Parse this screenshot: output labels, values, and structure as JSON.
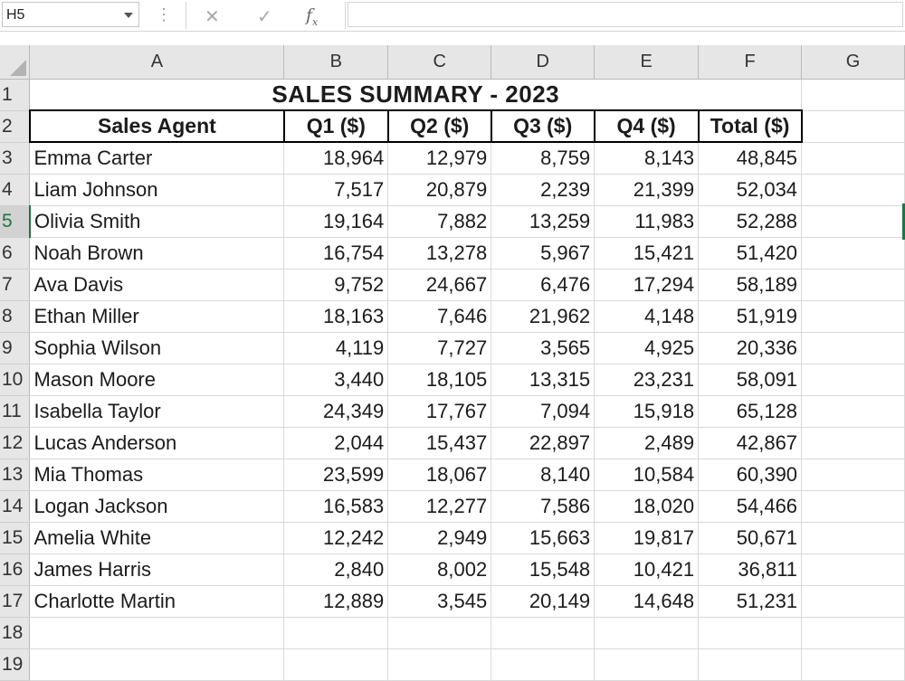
{
  "formula_bar": {
    "name_box": "H5",
    "formula": ""
  },
  "columns": [
    "A",
    "B",
    "C",
    "D",
    "E",
    "F",
    "G"
  ],
  "row_numbers": [
    "1",
    "2",
    "3",
    "4",
    "5",
    "6",
    "7",
    "8",
    "9",
    "10",
    "11",
    "12",
    "13",
    "14",
    "15",
    "16",
    "17",
    "18",
    "19"
  ],
  "sheet": {
    "title": "SALES SUMMARY - 2023",
    "headers": [
      "Sales Agent",
      "Q1 ($)",
      "Q2 ($)",
      "Q3 ($)",
      "Q4 ($)",
      "Total ($)"
    ],
    "rows": [
      [
        "Emma Carter",
        "18,964",
        "12,979",
        "8,759",
        "8,143",
        "48,845"
      ],
      [
        "Liam Johnson",
        "7,517",
        "20,879",
        "2,239",
        "21,399",
        "52,034"
      ],
      [
        "Olivia Smith",
        "19,164",
        "7,882",
        "13,259",
        "11,983",
        "52,288"
      ],
      [
        "Noah Brown",
        "16,754",
        "13,278",
        "5,967",
        "15,421",
        "51,420"
      ],
      [
        "Ava Davis",
        "9,752",
        "24,667",
        "6,476",
        "17,294",
        "58,189"
      ],
      [
        "Ethan Miller",
        "18,163",
        "7,646",
        "21,962",
        "4,148",
        "51,919"
      ],
      [
        "Sophia Wilson",
        "4,119",
        "7,727",
        "3,565",
        "4,925",
        "20,336"
      ],
      [
        "Mason Moore",
        "3,440",
        "18,105",
        "13,315",
        "23,231",
        "58,091"
      ],
      [
        "Isabella Taylor",
        "24,349",
        "17,767",
        "7,094",
        "15,918",
        "65,128"
      ],
      [
        "Lucas Anderson",
        "2,044",
        "15,437",
        "22,897",
        "2,489",
        "42,867"
      ],
      [
        "Mia Thomas",
        "23,599",
        "18,067",
        "8,140",
        "10,584",
        "60,390"
      ],
      [
        "Logan Jackson",
        "16,583",
        "12,277",
        "7,586",
        "18,020",
        "54,466"
      ],
      [
        "Amelia White",
        "12,242",
        "2,949",
        "15,663",
        "19,817",
        "50,671"
      ],
      [
        "James Harris",
        "2,840",
        "8,002",
        "15,548",
        "10,421",
        "36,811"
      ],
      [
        "Charlotte Martin",
        "12,889",
        "3,545",
        "20,149",
        "14,648",
        "51,231"
      ]
    ]
  },
  "selected_row": "5",
  "accent_color": "#217346"
}
